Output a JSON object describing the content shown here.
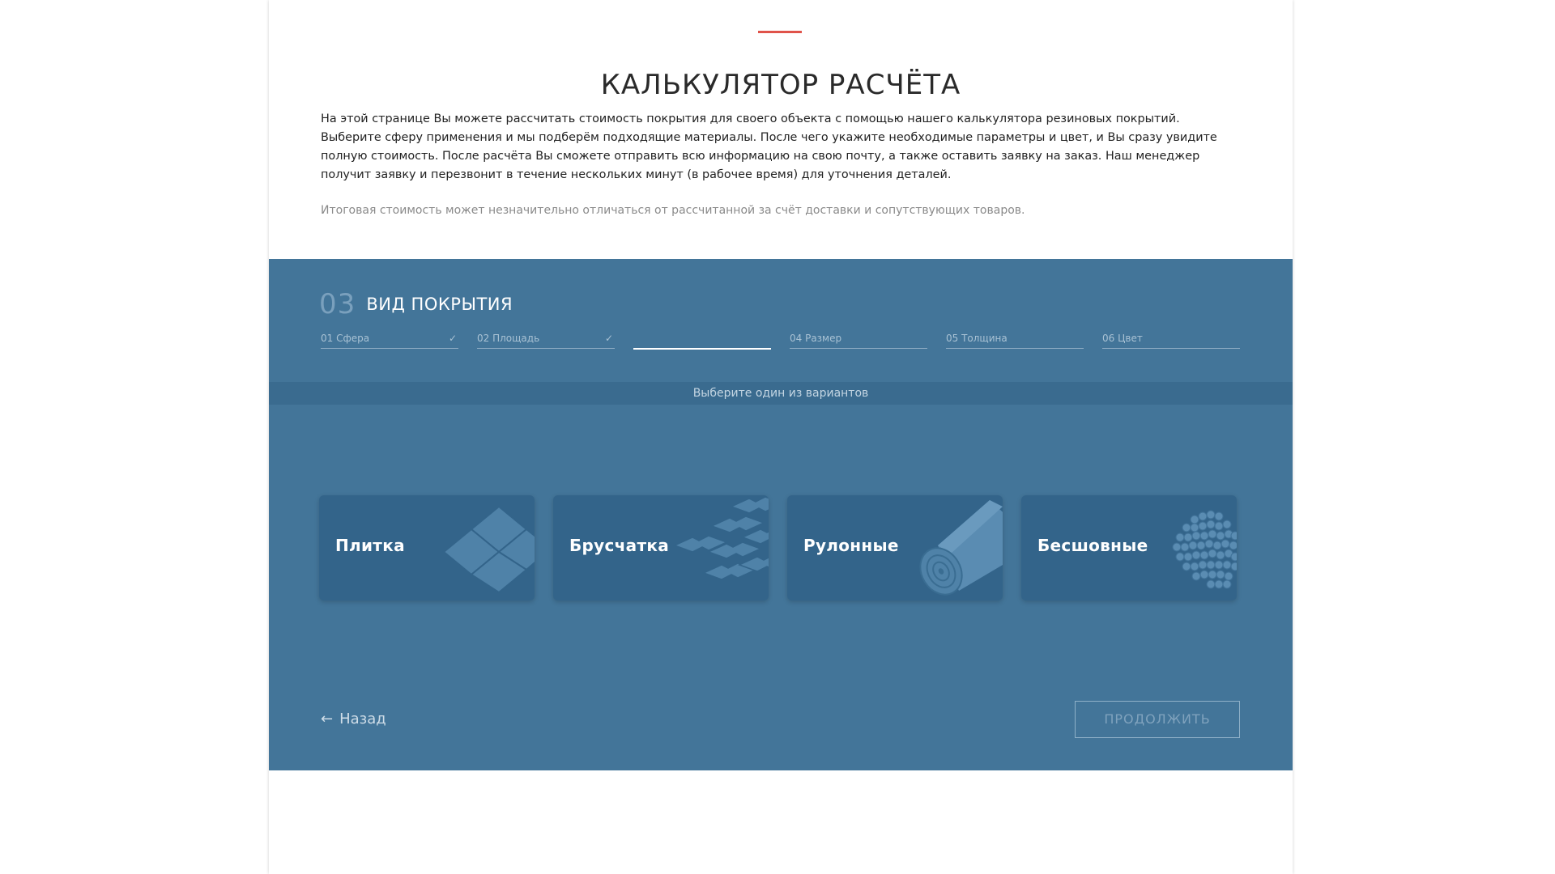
{
  "header": {
    "title": "КАЛЬКУЛЯТОР РАСЧЁТА",
    "intro": "На этой странице Вы можете рассчитать стоимость покрытия для своего объекта с помощью нашего калькулятора резиновых покрытий. Выберите сферу применения и мы подберём подходящие материалы. После чего укажите необходимые параметры и цвет, и Вы сразу увидите полную стоимость. После расчёта Вы сможете отправить всю информацию на свою почту, а также оставить заявку на заказ. Наш менеджер получит заявку и перезвонит в течение нескольких минут (в рабочее время) для уточнения деталей.",
    "note": "Итоговая стоимость может незначительно отличаться от рассчитанной за счёт доставки и сопутствующих товаров."
  },
  "calculator": {
    "step_number": "03",
    "step_title": "ВИД ПОКРЫТИЯ",
    "steps": [
      {
        "label": "01 Сфера",
        "done": true
      },
      {
        "label": "02 Площадь",
        "done": true
      },
      {
        "label": "",
        "active": true
      },
      {
        "label": "04 Размер"
      },
      {
        "label": "05 Толщина"
      },
      {
        "label": "06 Цвет"
      }
    ],
    "hint": "Выберите один из вариантов",
    "options": [
      {
        "label": "Плитка",
        "icon": "tiles-icon"
      },
      {
        "label": "Брусчатка",
        "icon": "paving-stones-icon"
      },
      {
        "label": "Рулонные",
        "icon": "roll-icon"
      },
      {
        "label": "Бесшовные",
        "icon": "crumb-icon"
      }
    ],
    "back_label": "Назад",
    "continue_label": "ПРОДОЛЖИТЬ"
  },
  "colors": {
    "accent": "#e0534a",
    "panel": "#437599",
    "card": "#33648a"
  }
}
